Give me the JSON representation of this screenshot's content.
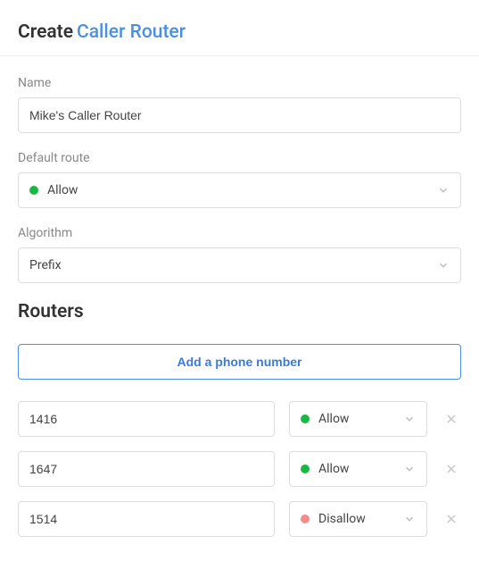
{
  "header": {
    "create_label": "Create",
    "title": "Caller Router"
  },
  "fields": {
    "name": {
      "label": "Name",
      "value": "Mike's Caller Router"
    },
    "default_route": {
      "label": "Default route",
      "value": "Allow",
      "status_color": "#1ab744"
    },
    "algorithm": {
      "label": "Algorithm",
      "value": "Prefix"
    }
  },
  "routers": {
    "title": "Routers",
    "add_label": "Add a phone number",
    "rows": [
      {
        "number": "1416",
        "route": "Allow",
        "status": "green"
      },
      {
        "number": "1647",
        "route": "Allow",
        "status": "green"
      },
      {
        "number": "1514",
        "route": "Disallow",
        "status": "red"
      }
    ]
  }
}
